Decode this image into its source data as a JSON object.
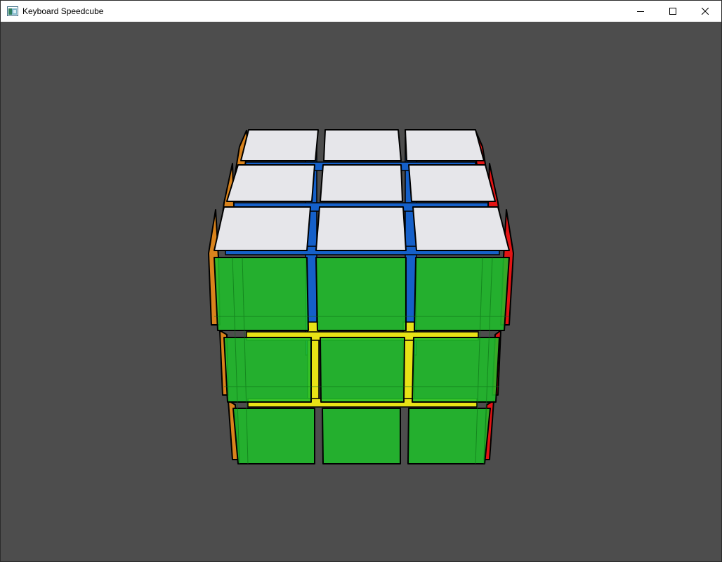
{
  "window": {
    "title": "Keyboard Speedcube",
    "icon": "app-window-icon",
    "controls": {
      "minimize": "minimize-icon",
      "maximize": "maximize-icon",
      "close": "close-icon"
    }
  },
  "viewport": {
    "background": "#4d4d4d"
  },
  "cube": {
    "size": "3x3x3",
    "view": "perspective, top face tilted toward viewer",
    "colors": {
      "top": "#e6e6ea",
      "front": "#1fbd2a",
      "left": "#d9831c",
      "right": "#e31414",
      "back": "#1560c9",
      "bottom": "#e8e216",
      "outline": "#000000"
    },
    "faces": {
      "top": [
        "white",
        "white",
        "white",
        "white",
        "white",
        "white",
        "white",
        "white",
        "white"
      ],
      "front": [
        "green",
        "green",
        "green",
        "green",
        "green",
        "green",
        "green",
        "green",
        "green"
      ]
    }
  }
}
